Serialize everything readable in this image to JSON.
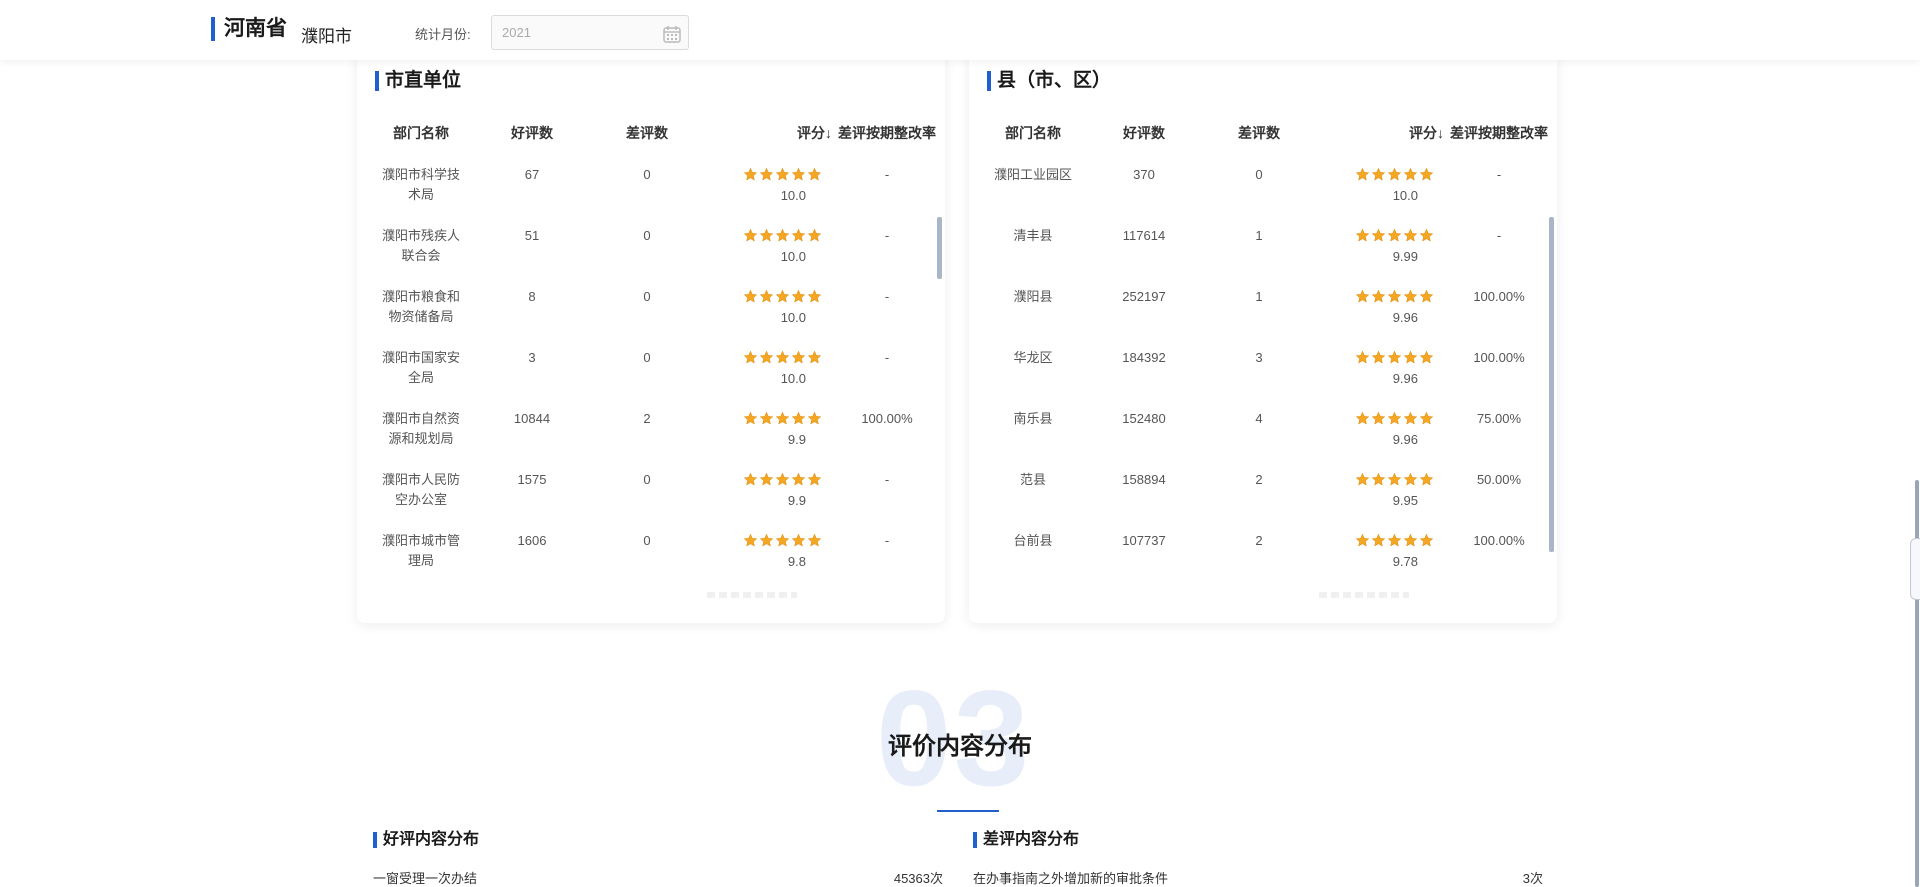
{
  "header": {
    "province": "河南省",
    "city": "濮阳市",
    "month_label": "统计月份:",
    "month_value": "2021"
  },
  "columns": {
    "name": "部门名称",
    "good": "好评数",
    "bad": "差评数",
    "score": "评分↓",
    "rate": "差评按期整改率"
  },
  "left_panel": {
    "title": "市直单位",
    "rows": [
      {
        "name": "濮阳市科学技术局",
        "good": "67",
        "bad": "0",
        "stars": 5,
        "score": "10.0",
        "rate": "-"
      },
      {
        "name": "濮阳市残疾人联合会",
        "good": "51",
        "bad": "0",
        "stars": 5,
        "score": "10.0",
        "rate": "-"
      },
      {
        "name": "濮阳市粮食和物资储备局",
        "good": "8",
        "bad": "0",
        "stars": 5,
        "score": "10.0",
        "rate": "-"
      },
      {
        "name": "濮阳市国家安全局",
        "good": "3",
        "bad": "0",
        "stars": 5,
        "score": "10.0",
        "rate": "-"
      },
      {
        "name": "濮阳市自然资源和规划局",
        "good": "10844",
        "bad": "2",
        "stars": 5,
        "score": "9.9",
        "rate": "100.00%"
      },
      {
        "name": "濮阳市人民防空办公室",
        "good": "1575",
        "bad": "0",
        "stars": 5,
        "score": "9.9",
        "rate": "-"
      },
      {
        "name": "濮阳市城市管理局",
        "good": "1606",
        "bad": "0",
        "stars": 5,
        "score": "9.8",
        "rate": "-"
      }
    ]
  },
  "right_panel": {
    "title": "县（市、区）",
    "rows": [
      {
        "name": "濮阳工业园区",
        "good": "370",
        "bad": "0",
        "stars": 5,
        "score": "10.0",
        "rate": "-"
      },
      {
        "name": "清丰县",
        "good": "117614",
        "bad": "1",
        "stars": 5,
        "score": "9.99",
        "rate": "-"
      },
      {
        "name": "濮阳县",
        "good": "252197",
        "bad": "1",
        "stars": 5,
        "score": "9.96",
        "rate": "100.00%"
      },
      {
        "name": "华龙区",
        "good": "184392",
        "bad": "3",
        "stars": 5,
        "score": "9.96",
        "rate": "100.00%"
      },
      {
        "name": "南乐县",
        "good": "152480",
        "bad": "4",
        "stars": 5,
        "score": "9.96",
        "rate": "75.00%"
      },
      {
        "name": "范县",
        "good": "158894",
        "bad": "2",
        "stars": 5,
        "score": "9.95",
        "rate": "50.00%"
      },
      {
        "name": "台前县",
        "good": "107737",
        "bad": "2",
        "stars": 5,
        "score": "9.78",
        "rate": "100.00%"
      }
    ]
  },
  "section": {
    "number": "03",
    "title": "评价内容分布"
  },
  "good_dist": {
    "title": "好评内容分布",
    "items": [
      {
        "label": "一窗受理一次办结",
        "count": "45363次"
      }
    ]
  },
  "bad_dist": {
    "title": "差评内容分布",
    "items": [
      {
        "label": "在办事指南之外增加新的审批条件",
        "count": "3次"
      }
    ]
  },
  "colors": {
    "accent": "#1f5fd0",
    "star": "#f5a623",
    "scrollbar": "#a9b6c8"
  }
}
